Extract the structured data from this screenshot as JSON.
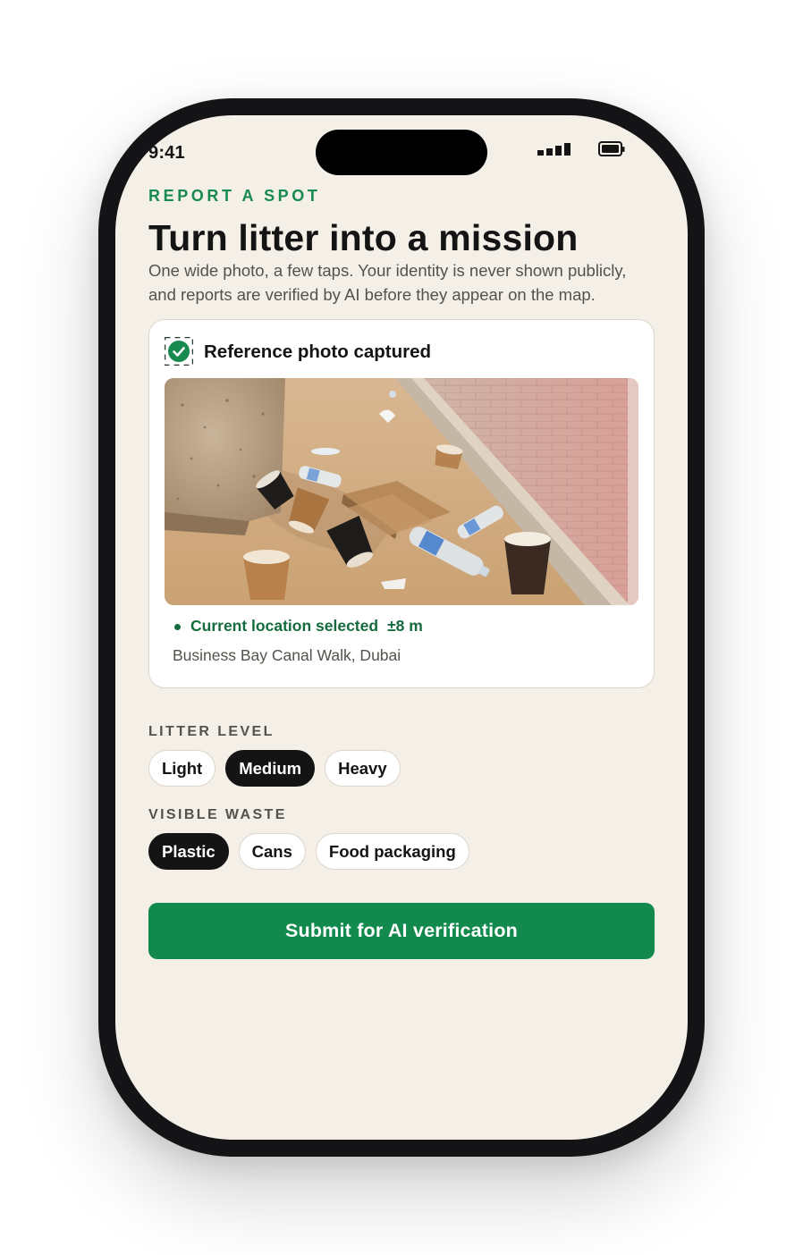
{
  "status_bar": {
    "time": "9:41",
    "signal_icon": "cellular-signal-icon",
    "battery_icon": "battery-icon"
  },
  "header": {
    "eyebrow": "REPORT A SPOT",
    "title": "Turn litter into a mission",
    "subtitle": "One wide photo, a few taps. Your identity is never shown publicly, and reports are verified by AI before they appear on the map."
  },
  "photo_card": {
    "status_icon": "check-circle-icon",
    "status_label": "Reference photo captured",
    "photo_subject": "litter on sand beside a paved walkway: cups, plastic bottles, a pizza box",
    "location_label": "Current location selected",
    "location_accuracy": "±8 m",
    "address": "Business Bay Canal Walk, Dubai"
  },
  "litter_level": {
    "label": "LITTER LEVEL",
    "options": [
      "Light",
      "Medium",
      "Heavy"
    ],
    "selected": "Medium"
  },
  "visible_waste": {
    "label": "VISIBLE WASTE",
    "options": [
      "Plastic",
      "Cans",
      "Food packaging"
    ],
    "selected": [
      "Plastic"
    ]
  },
  "submit": {
    "label": "Submit for AI verification"
  },
  "colors": {
    "accent_green": "#128a4d",
    "eyebrow_green": "#178a4f",
    "screen_background": "#f4efe7",
    "ink": "#141414",
    "muted_text": "#55524c"
  }
}
